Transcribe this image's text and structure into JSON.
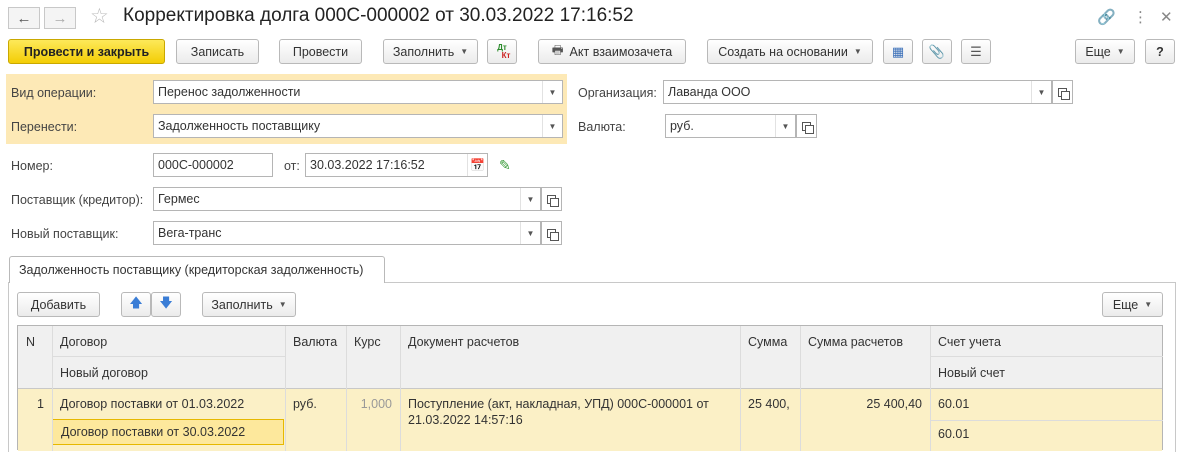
{
  "window": {
    "title": "Корректировка долга 000С-000002 от 30.03.2022 17:16:52"
  },
  "toolbar": {
    "post_close": "Провести и закрыть",
    "save": "Записать",
    "post": "Провести",
    "fill": "Заполнить",
    "dt_kt_top": "Дт",
    "dt_kt_bottom": "Кт",
    "offset_act": "Акт взаимозачета",
    "create_based": "Создать на основании",
    "more": "Еще",
    "help": "?"
  },
  "form": {
    "operation_type": {
      "label": "Вид операции:",
      "value": "Перенос задолженности"
    },
    "transfer": {
      "label": "Перенести:",
      "value": "Задолженность поставщику"
    },
    "organization": {
      "label": "Организация:",
      "value": "Лаванда ООО"
    },
    "currency": {
      "label": "Валюта:",
      "value": "руб."
    },
    "number": {
      "label": "Номер:",
      "value": "000С-000002"
    },
    "date": {
      "label": "от:",
      "value": "30.03.2022 17:16:52"
    },
    "supplier": {
      "label": "Поставщик (кредитор):",
      "value": "Гермес"
    },
    "new_supplier": {
      "label": "Новый поставщик:",
      "value": "Вега-транс"
    }
  },
  "tab": {
    "label": "Задолженность поставщику (кредиторская задолженность)"
  },
  "table_toolbar": {
    "add": "Добавить",
    "fill": "Заполнить",
    "more": "Еще"
  },
  "table": {
    "headers": {
      "n": "N",
      "contract": "Договор",
      "new_contract": "Новый договор",
      "currency": "Валюта",
      "rate": "Курс",
      "doc": "Документ расчетов",
      "sum": "Сумма",
      "sum_calc": "Сумма расчетов",
      "account": "Счет учета",
      "new_account": "Новый счет"
    },
    "rows": [
      {
        "n": "1",
        "contract": "Договор поставки от 01.03.2022",
        "new_contract": "Договор поставки от 30.03.2022",
        "currency": "руб.",
        "rate": "1,000",
        "doc_line1": "Поступление (акт, накладная, УПД) 000С-000001 от",
        "doc_line2": "21.03.2022 14:57:16",
        "sum": "25 400,",
        "sum_calc": "25 400,40",
        "account": "60.01",
        "new_account": "60.01"
      }
    ]
  },
  "colors": {
    "primary_button": "#f3cd05",
    "highlight_zone": "#fde9b6",
    "selected_row": "#fbf0c6"
  }
}
